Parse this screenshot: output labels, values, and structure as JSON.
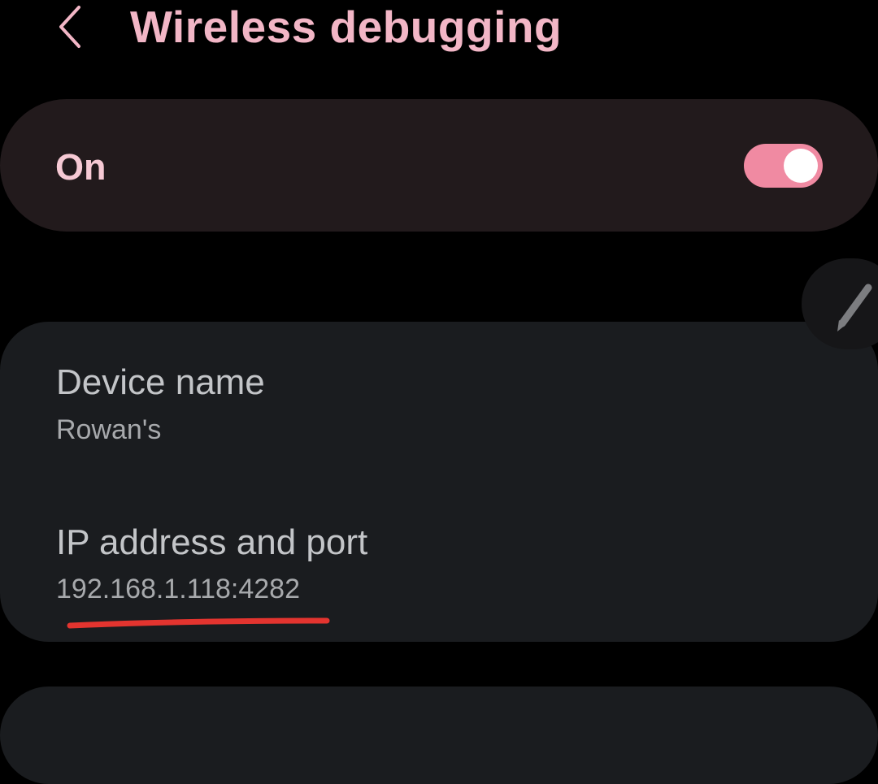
{
  "header": {
    "back_icon": "chevron-left-icon",
    "title": "Wireless debugging"
  },
  "master_switch": {
    "label": "On",
    "checked": true,
    "accent_color": "#f08aa2"
  },
  "edit_button": {
    "icon": "pencil-icon"
  },
  "info": {
    "device_name": {
      "title": "Device name",
      "value": "Rowan's"
    },
    "ip_address": {
      "title": "IP address and port",
      "value": "192.168.1.118:4282"
    }
  },
  "annotation": {
    "color": "#e3342f"
  },
  "colors": {
    "background": "#000000",
    "title": "#f2b6c6",
    "card": "#1a1c1f",
    "switch_card": "#221a1c"
  }
}
